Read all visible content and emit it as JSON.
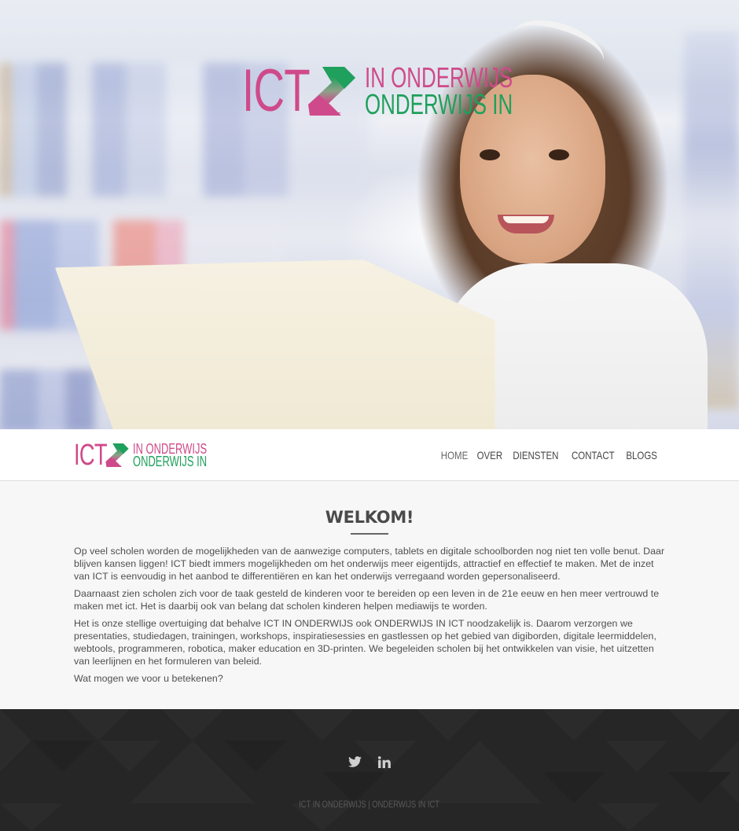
{
  "brand": {
    "logo_ict": "ICT",
    "logo_line1": "IN ONDERWIJS",
    "logo_line2": "ONDERWIJS IN",
    "colors": {
      "pink": "#cf4a8a",
      "green": "#1fa05c"
    }
  },
  "hero": {
    "image_description": "Smiling girl with curly hair behind a laptop in a library"
  },
  "nav": {
    "items": [
      {
        "label": "HOME",
        "active": true
      },
      {
        "label": "OVER",
        "active": false
      },
      {
        "label": "DIENSTEN",
        "active": false
      },
      {
        "label": "CONTACT",
        "active": false
      },
      {
        "label": "BLOGS",
        "active": false
      }
    ]
  },
  "main": {
    "title": "WELKOM!",
    "paragraphs": [
      "Op veel scholen worden de mogelijkheden van de aanwezige computers, tablets en digitale schoolborden nog niet ten volle benut. Daar blijven kansen liggen! ICT biedt immers mogelijkheden om het onderwijs meer eigentijds, attractief en effectief te maken. Met de inzet van ICT is eenvoudig in het aanbod te differentiëren en kan het onderwijs verregaand worden gepersonaliseerd.",
      "Daarnaast zien scholen zich voor de taak gesteld de kinderen voor te bereiden op een leven in de 21e eeuw en hen meer vertrouwd te maken met ict. Het is daarbij ook van belang dat scholen kinderen helpen mediawijs te worden.",
      "Het is onze stellige overtuiging dat behalve ICT IN ONDERWIJS ook ONDERWIJS IN ICT noodzakelijk is. Daarom verzorgen we presentaties, studiedagen, trainingen, workshops, inspiratiesessies en gastlessen op het gebied van digiborden, digitale leermiddelen, webtools, programmeren, robotica, maker education en 3D-printen. We begeleiden scholen bij het ontwikkelen van visie, het uitzetten van leerlijnen en het formuleren van beleid.",
      "Wat mogen we voor u betekenen?"
    ]
  },
  "footer": {
    "social": [
      {
        "name": "twitter",
        "icon": "twitter-icon"
      },
      {
        "name": "linkedin",
        "icon": "linkedin-icon"
      }
    ],
    "copyright": "ICT IN ONDERWIJS | ONDERWIJS IN ICT"
  }
}
